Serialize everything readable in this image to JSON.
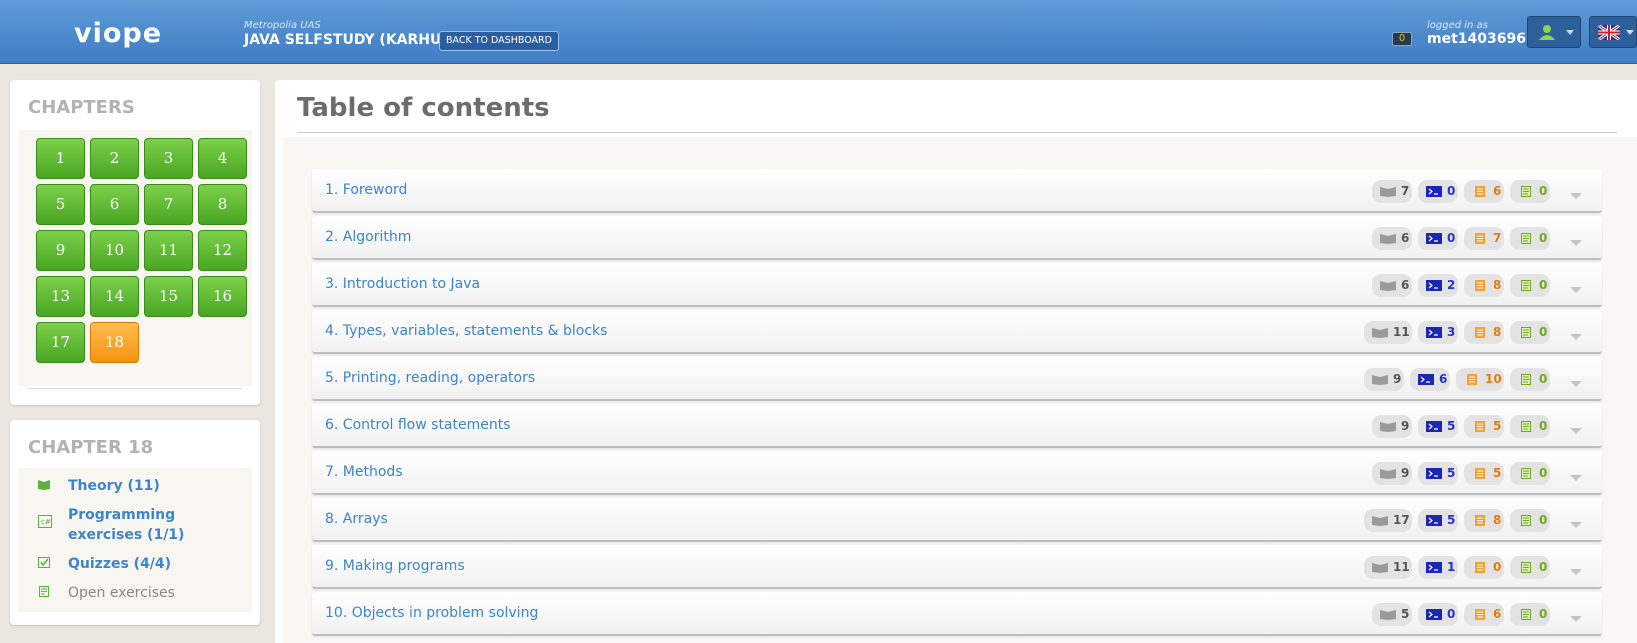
{
  "header": {
    "logo": "viope",
    "organization": "Metropolia UAS",
    "course_title": "JAVA SELFSTUDY (KARHU)",
    "back_button": "BACK TO DASHBOARD",
    "notification_count": "0",
    "logged_in_label": "logged in as",
    "username": "met1403696",
    "user_menu_icon": "user-icon",
    "language_icon": "uk-flag-icon"
  },
  "sidebar": {
    "chapters_title": "CHAPTERS",
    "chapters": [
      "1",
      "2",
      "3",
      "4",
      "5",
      "6",
      "7",
      "8",
      "9",
      "10",
      "11",
      "12",
      "13",
      "14",
      "15",
      "16",
      "17",
      "18"
    ],
    "current_chapter": "18",
    "chapter_panel_title": "CHAPTER 18",
    "chapter_items": [
      {
        "label": "Theory (11)",
        "icon": "book-icon"
      },
      {
        "label": "Programming exercises (1/1)",
        "icon": "code-icon"
      },
      {
        "label": "Quizzes (4/4)",
        "icon": "checkbox-icon"
      },
      {
        "label": "Open exercises",
        "icon": "document-icon"
      }
    ]
  },
  "main": {
    "title": "Table of contents",
    "rows": [
      {
        "title": "1. Foreword",
        "theory": "7",
        "programming": "0",
        "quizzes": "6",
        "open": "0"
      },
      {
        "title": "2. Algorithm",
        "theory": "6",
        "programming": "0",
        "quizzes": "7",
        "open": "0"
      },
      {
        "title": "3. Introduction to Java",
        "theory": "6",
        "programming": "2",
        "quizzes": "8",
        "open": "0"
      },
      {
        "title": "4. Types, variables, statements & blocks",
        "theory": "11",
        "programming": "3",
        "quizzes": "8",
        "open": "0"
      },
      {
        "title": "5. Printing, reading, operators",
        "theory": "9",
        "programming": "6",
        "quizzes": "10",
        "open": "0"
      },
      {
        "title": "6. Control flow statements",
        "theory": "9",
        "programming": "5",
        "quizzes": "5",
        "open": "0"
      },
      {
        "title": "7. Methods",
        "theory": "9",
        "programming": "5",
        "quizzes": "5",
        "open": "0"
      },
      {
        "title": "8. Arrays",
        "theory": "17",
        "programming": "5",
        "quizzes": "8",
        "open": "0"
      },
      {
        "title": "9. Making programs",
        "theory": "11",
        "programming": "1",
        "quizzes": "0",
        "open": "0"
      },
      {
        "title": "10. Objects in problem solving",
        "theory": "5",
        "programming": "0",
        "quizzes": "6",
        "open": "0"
      }
    ]
  },
  "colors": {
    "header": "#4a88cc",
    "chapter_button": "#5cb835",
    "current_chapter": "#f7a026",
    "link": "#3d84c8",
    "theory": "#555555",
    "programming": "#2a30c8",
    "quizzes": "#e07c12",
    "open": "#74a81f"
  }
}
